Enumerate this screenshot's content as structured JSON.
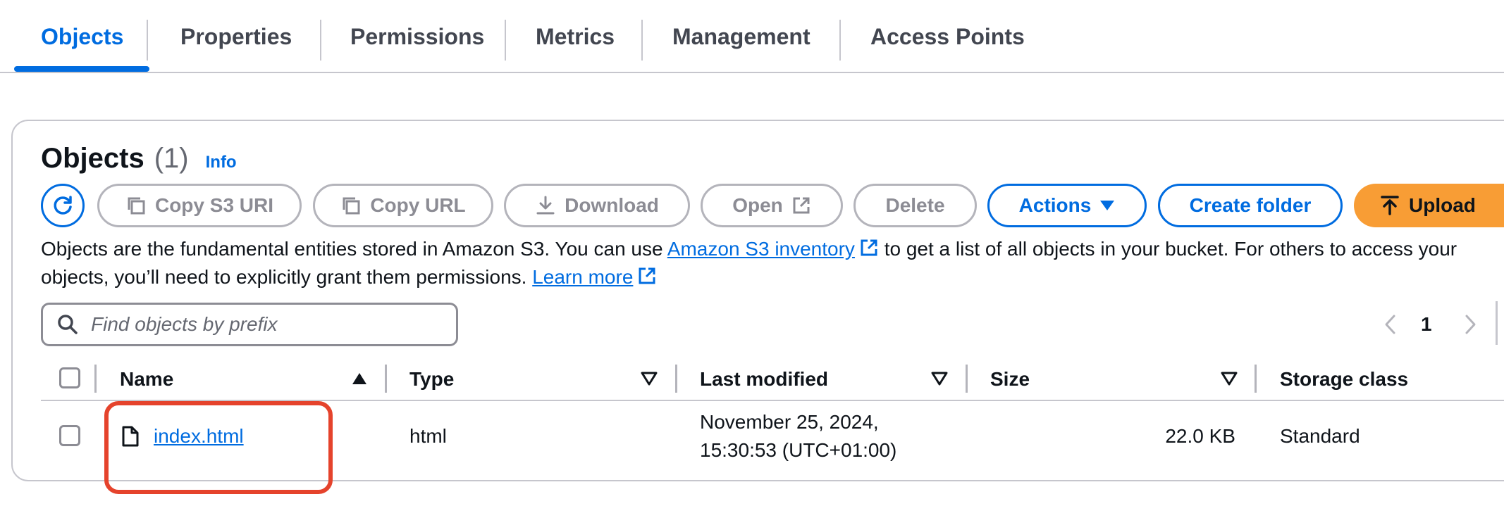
{
  "tabs": [
    {
      "label": "Objects",
      "active": true
    },
    {
      "label": "Properties"
    },
    {
      "label": "Permissions"
    },
    {
      "label": "Metrics"
    },
    {
      "label": "Management"
    },
    {
      "label": "Access Points"
    }
  ],
  "objects_panel": {
    "title": "Objects",
    "count": "(1)",
    "info_link": "Info"
  },
  "toolbar": {
    "refresh_icon": "refresh-icon",
    "copy_s3_uri": "Copy S3 URI",
    "copy_url": "Copy URL",
    "download": "Download",
    "open": "Open",
    "delete": "Delete",
    "actions": "Actions",
    "create_folder": "Create folder",
    "upload": "Upload"
  },
  "description": {
    "part1": "Objects are the fundamental entities stored in Amazon S3. You can use ",
    "inventory_link": "Amazon S3 inventory",
    "part2": " to get a list of all objects in your bucket. For others to access your objects, you’ll need to explicitly grant them permissions. ",
    "learn_more": "Learn more"
  },
  "search": {
    "placeholder": "Find objects by prefix",
    "value": ""
  },
  "pagination": {
    "current_page": "1"
  },
  "table": {
    "columns": [
      "Name",
      "Type",
      "Last modified",
      "Size",
      "Storage class"
    ],
    "rows": [
      {
        "name": "index.html",
        "type": "html",
        "last_modified_line1": "November 25, 2024,",
        "last_modified_line2": "15:30:53 (UTC+01:00)",
        "size": "22.0 KB",
        "storage_class": "Standard"
      }
    ]
  },
  "colors": {
    "accent": "#006ce0",
    "upload_button": "#f89d35",
    "highlight": "#e5432c",
    "disabled": "#8c8c94"
  }
}
